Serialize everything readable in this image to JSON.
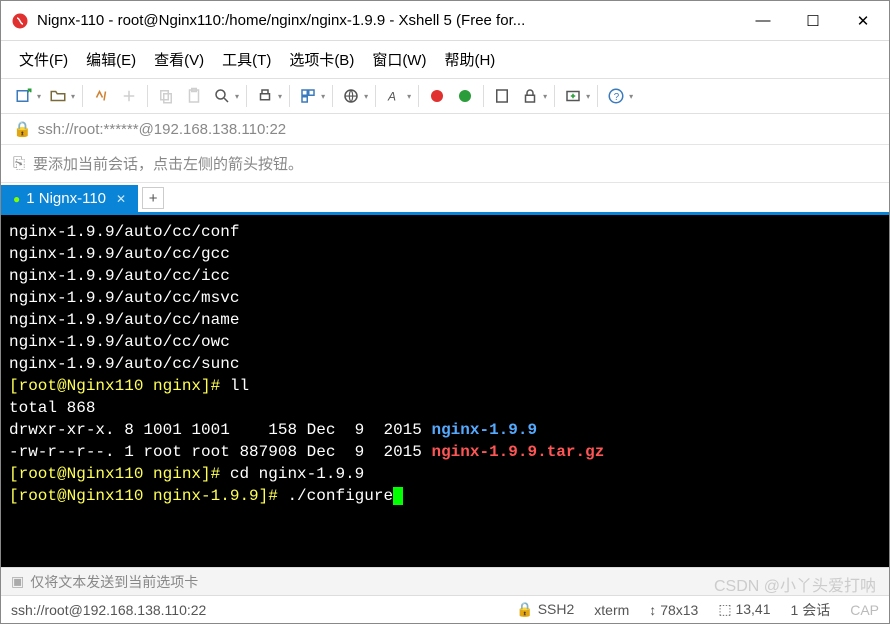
{
  "window": {
    "title": "Nignx-110 - root@Nginx110:/home/nginx/nginx-1.9.9 - Xshell 5 (Free for...",
    "minimize": "—",
    "maximize": "☐",
    "close": "✕"
  },
  "menu": {
    "file": "文件(F)",
    "edit": "编辑(E)",
    "view": "查看(V)",
    "tools": "工具(T)",
    "tabs": "选项卡(B)",
    "window": "窗口(W)",
    "help": "帮助(H)"
  },
  "address": {
    "url": "ssh://root:******@192.168.138.110:22"
  },
  "hint": {
    "text": "要添加当前会话，点击左侧的箭头按钮。"
  },
  "tab": {
    "label": "1 Nignx-110",
    "add": "+"
  },
  "terminal": {
    "lines": [
      "nginx-1.9.9/auto/cc/conf",
      "nginx-1.9.9/auto/cc/gcc",
      "nginx-1.9.9/auto/cc/icc",
      "nginx-1.9.9/auto/cc/msvc",
      "nginx-1.9.9/auto/cc/name",
      "nginx-1.9.9/auto/cc/owc",
      "nginx-1.9.9/auto/cc/sunc"
    ],
    "prompt1_a": "[root@Nginx110 nginx]# ",
    "prompt1_b": "ll",
    "total": "total 868",
    "ls1_a": "drwxr-xr-x. 8 1001 1001    158 Dec  9  2015 ",
    "ls1_b": "nginx-1.9.9",
    "ls2_a": "-rw-r--r--. 1 root root 887908 Dec  9  2015 ",
    "ls2_b": "nginx-1.9.9.tar.gz",
    "prompt2_a": "[root@Nginx110 nginx]# ",
    "prompt2_b": "cd nginx-1.9.9",
    "prompt3_a": "[root@Nginx110 nginx-1.9.9]# ",
    "prompt3_b": "./configure"
  },
  "inputbar": {
    "text": "仅将文本发送到当前选项卡"
  },
  "status": {
    "conn": "ssh://root@192.168.138.110:22",
    "proto": "SSH2",
    "term": "xterm",
    "size": "78x13",
    "pos": "13,41",
    "session": "1 会话",
    "cap": "CAP"
  },
  "watermark": "CSDN @小丫头爱打呐"
}
